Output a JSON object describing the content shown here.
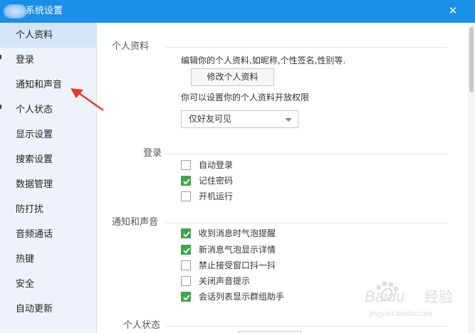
{
  "window": {
    "title": "系统设置",
    "close_label": "✕"
  },
  "sidebar": {
    "items": [
      {
        "label": "个人资料",
        "active": true
      },
      {
        "label": "登录"
      },
      {
        "label": "通知和声音"
      },
      {
        "label": "个人状态"
      },
      {
        "label": "显示设置"
      },
      {
        "label": "搜索设置"
      },
      {
        "label": "数据管理"
      },
      {
        "label": "防打扰"
      },
      {
        "label": "音频通话"
      },
      {
        "label": "热键"
      },
      {
        "label": "安全"
      },
      {
        "label": "自动更新"
      }
    ]
  },
  "profile": {
    "section_title": "个人资料",
    "description": "编辑你的个人资料,如昵称,个性签名,性别等.",
    "edit_button": "修改个人资料",
    "permission_text": "你可以设置你的个人资料开放权限",
    "permission_select": "仅好友可见"
  },
  "login": {
    "section_title": "登录",
    "options": [
      {
        "label": "自动登录",
        "checked": false
      },
      {
        "label": "记住密码",
        "checked": true
      },
      {
        "label": "开机运行",
        "checked": false
      }
    ]
  },
  "notify": {
    "section_title": "通知和声音",
    "options": [
      {
        "label": "收到消息时气泡提醒",
        "checked": true
      },
      {
        "label": "新消息气泡显示详情",
        "checked": true
      },
      {
        "label": "禁止接受窗口抖一抖",
        "checked": false
      },
      {
        "label": "关闭声音提示",
        "checked": false
      },
      {
        "label": "会话列表显示群组助手",
        "checked": true
      }
    ]
  },
  "status": {
    "section_title": "个人状态"
  },
  "watermark": {
    "brand": "Baidu",
    "text": "经验",
    "url": "jingyan.baidu.com"
  },
  "colors": {
    "titlebar": "#1a8fe8",
    "sidebar_bg": "#eef3f9",
    "sidebar_active": "#d3e5f7",
    "checkbox_on": "#3fa64a",
    "annotation_arrow": "#e8392f"
  },
  "icons": {
    "close": "close-icon",
    "dropdown": "chevron-down-icon",
    "check": "checkmark-icon",
    "annotation": "arrow-icon"
  }
}
